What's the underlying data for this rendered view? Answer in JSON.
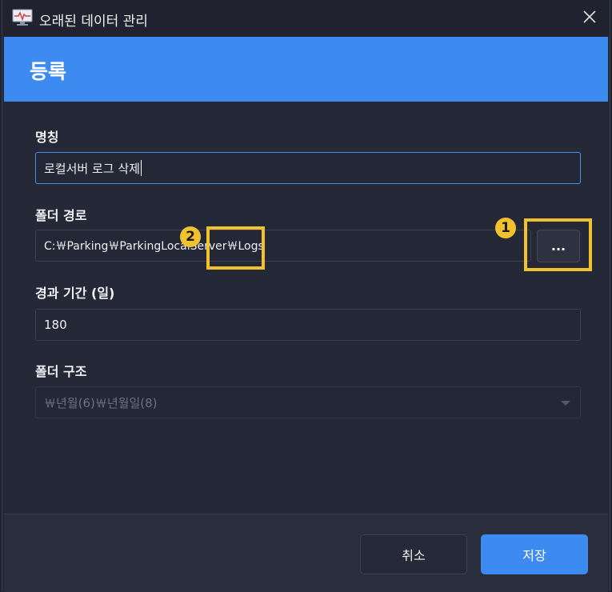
{
  "window": {
    "title": "오래된 데이터 관리"
  },
  "header": {
    "title": "등록"
  },
  "form": {
    "name_label": "명칭",
    "name_value": "로컬서버 로그 삭제",
    "folder_path_label": "폴더 경로",
    "folder_path_value": "C:￦Parking￦ParkingLocalServer￦Logs",
    "browse_label": "...",
    "elapsed_label": "경과 기간 (일)",
    "elapsed_value": "180",
    "folder_structure_label": "폴더 구조",
    "folder_structure_value": "￦년월(6)￦년월일(8)"
  },
  "annotations": {
    "badge_1": "1",
    "badge_2": "2"
  },
  "footer": {
    "cancel_label": "취소",
    "save_label": "저장"
  },
  "colors": {
    "accent": "#3d8bf0",
    "highlight": "#f2c12e",
    "background": "#252836"
  }
}
